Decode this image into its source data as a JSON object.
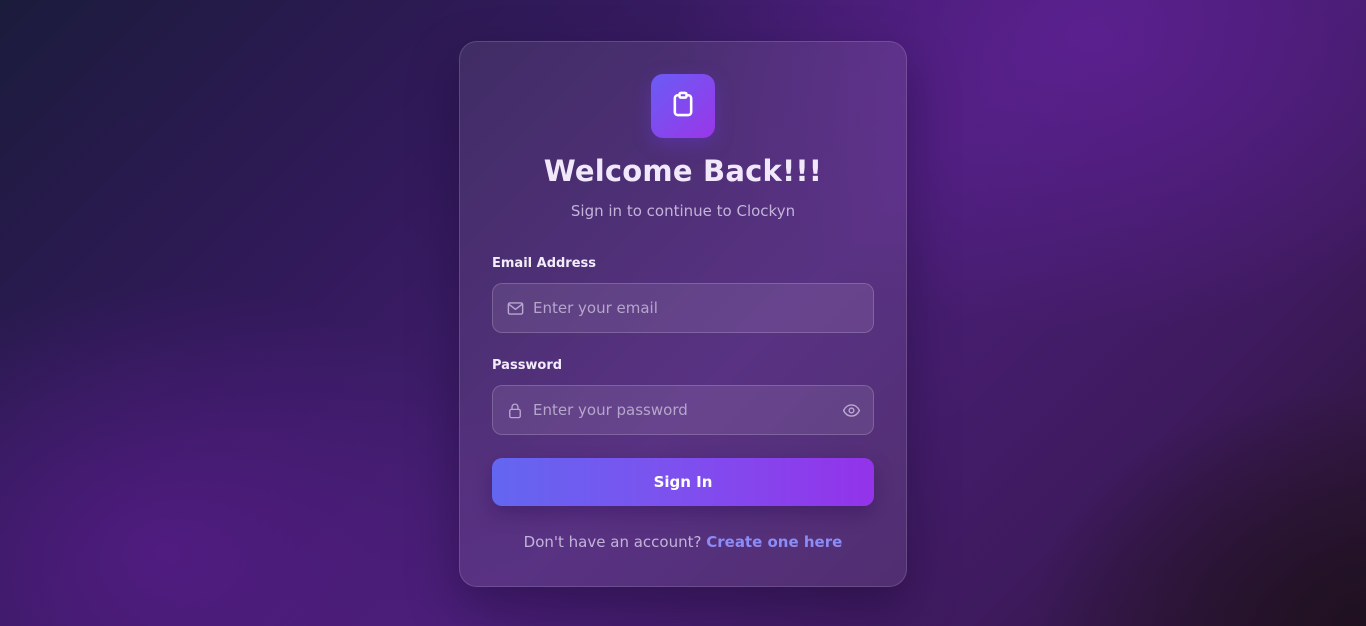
{
  "brand": {
    "logo_icon": "clipboard-icon",
    "logo_gradient": [
      "#6a5cf5",
      "#9a36e8"
    ]
  },
  "header": {
    "title": "Welcome Back!!!",
    "subtitle": "Sign in to continue to Clockyn"
  },
  "form": {
    "email": {
      "label": "Email Address",
      "placeholder": "Enter your email",
      "value": "",
      "icon": "mail-icon"
    },
    "password": {
      "label": "Password",
      "placeholder": "Enter your password",
      "value": "",
      "icon": "lock-icon",
      "toggle_icon": "eye-icon"
    },
    "submit_label": "Sign In"
  },
  "footer": {
    "prompt": "Don't have an account?",
    "link_label": "Create one here"
  },
  "colors": {
    "accent_start": "#6366f1",
    "accent_end": "#9333ea",
    "link": "#8c8cf7"
  }
}
